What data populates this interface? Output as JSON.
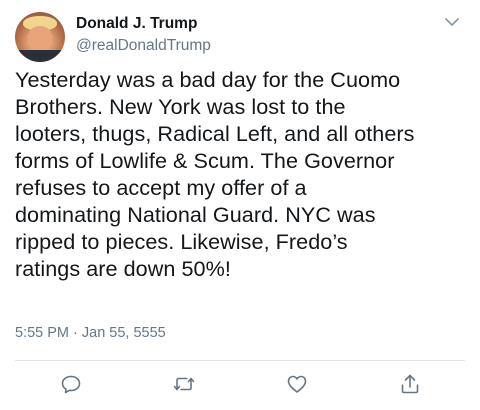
{
  "tweet": {
    "author": {
      "name": "Donald J. Trump",
      "handle": "@realDonaldTrump"
    },
    "text_lines": [
      "Yesterday was a bad day for the Cuomo",
      "Brothers. New York was lost to the",
      "looters, thugs, Radical Left, and all others",
      "forms of Lowlife & Scum. The Governor",
      "refuses to accept my offer of a",
      "dominating National Guard. NYC was",
      "ripped to pieces. Likewise, Fredo’s",
      "ratings are down 50%!"
    ],
    "timestamp": "5:55 PM · Jan 55, 5555"
  },
  "icons": {
    "menu": "chevron-down-icon",
    "reply": "reply-icon",
    "retweet": "retweet-icon",
    "like": "heart-icon",
    "share": "share-icon"
  },
  "colors": {
    "text": "#14171a",
    "secondary": "#657786",
    "divider": "#e1e8ed"
  }
}
